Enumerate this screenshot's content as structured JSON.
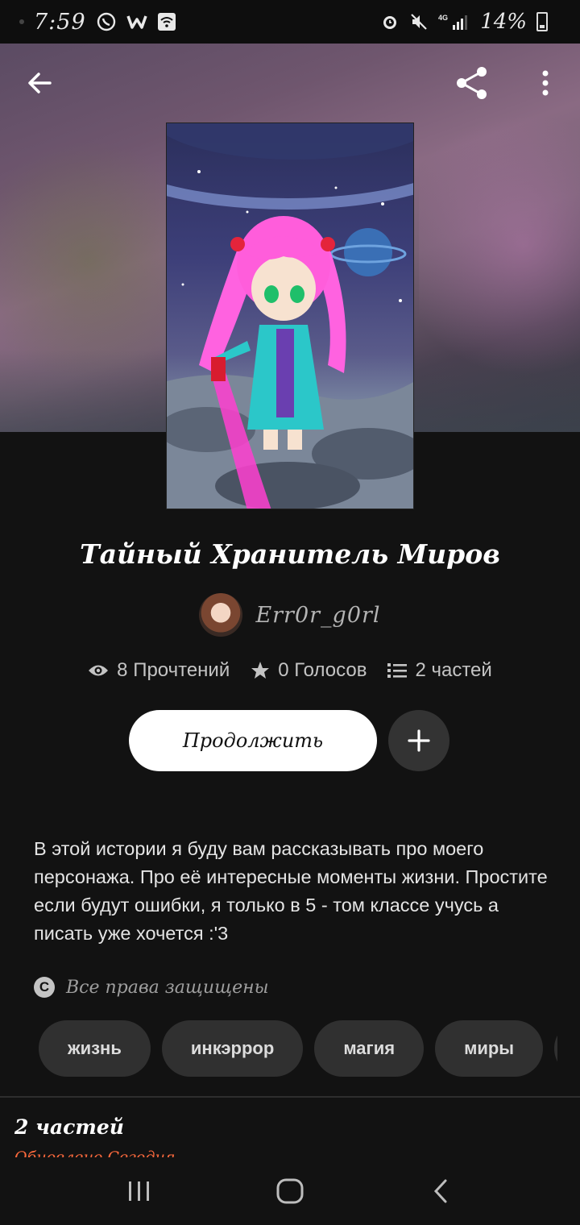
{
  "status_bar": {
    "time": "7:59",
    "battery": "14%",
    "network": "4G"
  },
  "story": {
    "title": "Тайный Хранитель Миров",
    "author": "Err0r_g0rl",
    "stats": {
      "reads": "8 Прочтений",
      "votes": "0 Голосов",
      "parts": "2 частей"
    },
    "continue_label": "Продолжить",
    "description": "В этой истории я буду вам рассказывать про моего персонажа. Про её интересные моменты жизни. Простите если будут ошибки, я только в 5 - том классе учусь а писать уже хочется :'3",
    "copyright": "Все права защищены",
    "tags": [
      "жизнь",
      "инкэррор",
      "магия",
      "миры",
      ""
    ]
  },
  "parts_section": {
    "title": "2 частей",
    "updated": "Обновлено Сегодня"
  },
  "colors": {
    "background": "#121212",
    "accent_updated": "#ff6a3d",
    "button_primary": "#ffffff",
    "chip": "#303030"
  }
}
